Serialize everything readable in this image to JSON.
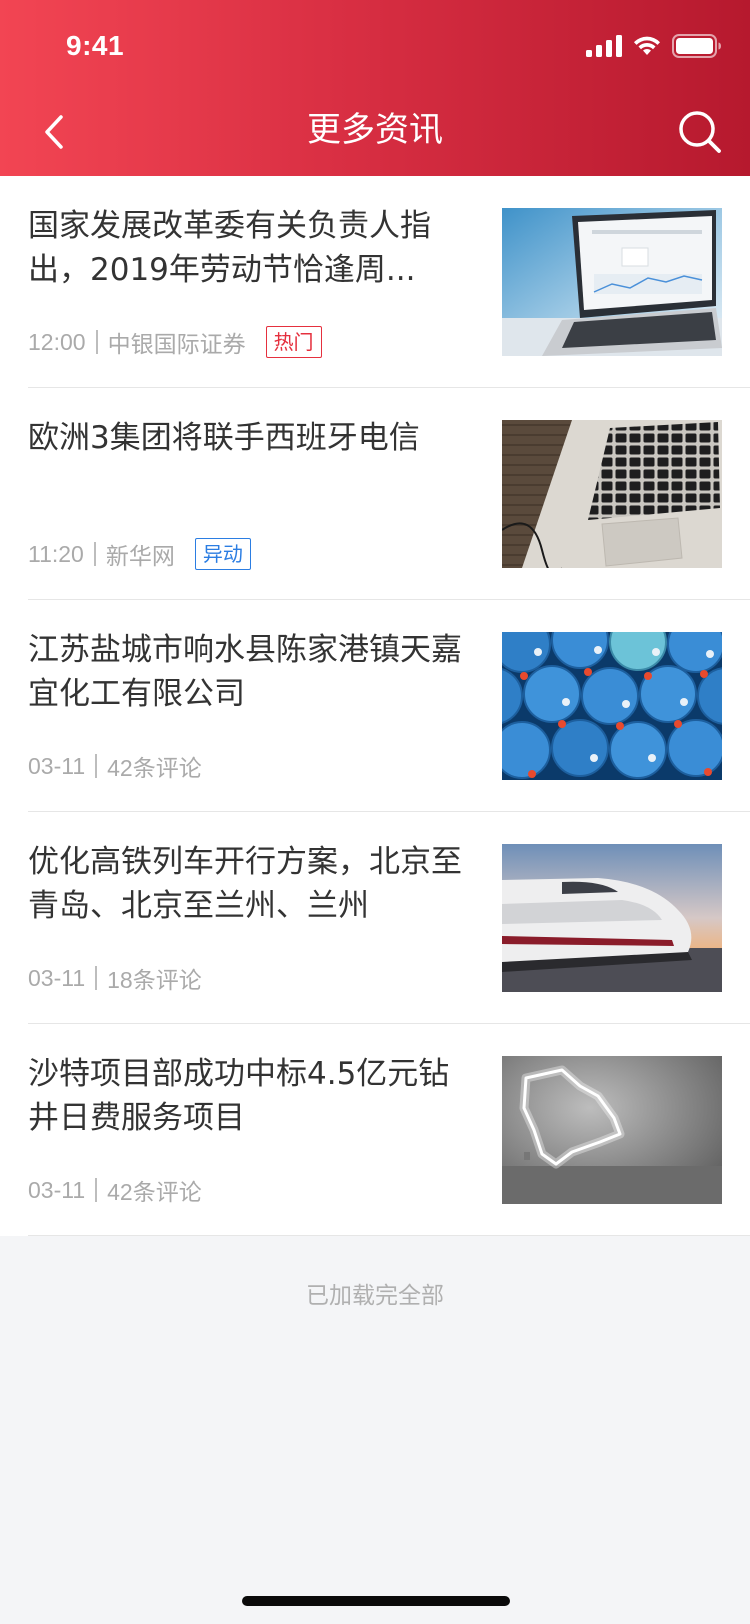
{
  "status_bar": {
    "time": "9:41"
  },
  "nav": {
    "title": "更多资讯",
    "back_icon": "chevron-left-icon",
    "search_icon": "search-icon"
  },
  "news": [
    {
      "title": "国家发展改革委有关负责人指出，2019年劳动节恰逢周...",
      "time": "12:00",
      "source": "中银国际证券",
      "tag": "热门",
      "tag_color": "#e5303e",
      "image": "laptop-dashboard-photo"
    },
    {
      "title": "欧洲3集团将联手西班牙电信",
      "time": "11:20",
      "source": "新华网",
      "tag": "异动",
      "tag_color": "#2b7de2",
      "image": "laptop-keyboard-photo"
    },
    {
      "title": "江苏盐城市响水县陈家港镇天嘉宜化工有限公司",
      "time": "03-11",
      "source": "42条评论",
      "image": "blue-barrels-photo"
    },
    {
      "title": "优化高铁列车开行方案，北京至青岛、北京至兰州、兰州",
      "time": "03-11",
      "source": "18条评论",
      "image": "high-speed-train-photo"
    },
    {
      "title": "沙特项目部成功中标4.5亿元钻井日费服务项目",
      "time": "03-11",
      "source": "42条评论",
      "image": "saudi-map-neon-photo"
    }
  ],
  "footer": {
    "load_all": "已加载完全部"
  },
  "colors": {
    "header_gradient_start": "#f24553",
    "header_gradient_end": "#b6192e",
    "hot_tag": "#e5303e",
    "move_tag": "#2b7de2"
  }
}
